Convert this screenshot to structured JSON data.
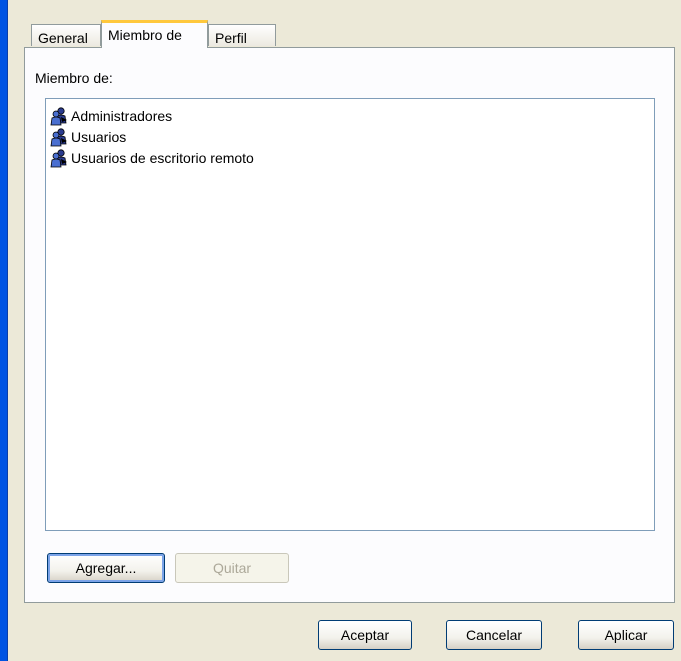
{
  "tabs": [
    {
      "label": "General",
      "active": false
    },
    {
      "label": "Miembro de",
      "active": true
    },
    {
      "label": "Perfil",
      "active": false
    }
  ],
  "panel": {
    "label": "Miembro de:",
    "members": [
      {
        "name": "Administradores",
        "icon": "group-icon"
      },
      {
        "name": "Usuarios",
        "icon": "group-icon"
      },
      {
        "name": "Usuarios de escritorio remoto",
        "icon": "group-icon"
      }
    ],
    "add_button": "Agregar...",
    "remove_button": "Quitar"
  },
  "footer": {
    "ok_button": "Aceptar",
    "cancel_button": "Cancelar",
    "apply_button": "Aplicar"
  },
  "colors": {
    "dialog_bg": "#ece9d8",
    "panel_bg": "#fcfcfe",
    "active_tab_accent": "#ffc83c",
    "button_border": "#003c74",
    "disabled_text": "#aca899"
  }
}
